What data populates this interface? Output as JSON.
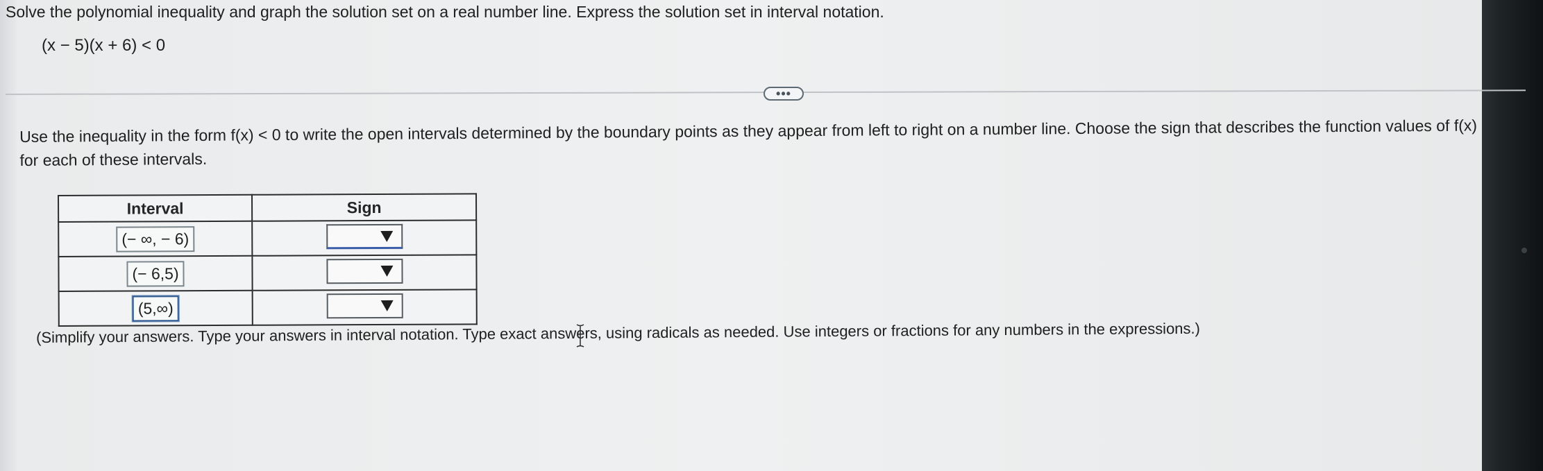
{
  "problem": {
    "title": "Solve the polynomial inequality and graph the solution set on a real number line. Express the solution set in interval notation.",
    "equation": "(x − 5)(x + 6) < 0"
  },
  "more_button": {
    "label": "•••"
  },
  "instruction": {
    "text": "Use the inequality in the form f(x) < 0 to write the open intervals determined by the boundary points as they appear from left to right on a number line. Choose the sign that describes the function values of f(x) for each of these intervals."
  },
  "table": {
    "headers": {
      "interval": "Interval",
      "sign": "Sign"
    },
    "rows": [
      {
        "interval": "(− ∞, − 6)",
        "sign": ""
      },
      {
        "interval": "(− 6,5)",
        "sign": ""
      },
      {
        "interval": "(5,∞)",
        "sign": ""
      }
    ]
  },
  "note": {
    "text": "(Simplify your answers. Type your answers in interval notation. Type exact answers, using radicals as needed. Use integers or fractions for any numbers in the expressions.)"
  },
  "icons": {
    "dropdown": "chevron-down-icon",
    "cursor": "text-cursor-icon",
    "more": "ellipsis-icon"
  }
}
